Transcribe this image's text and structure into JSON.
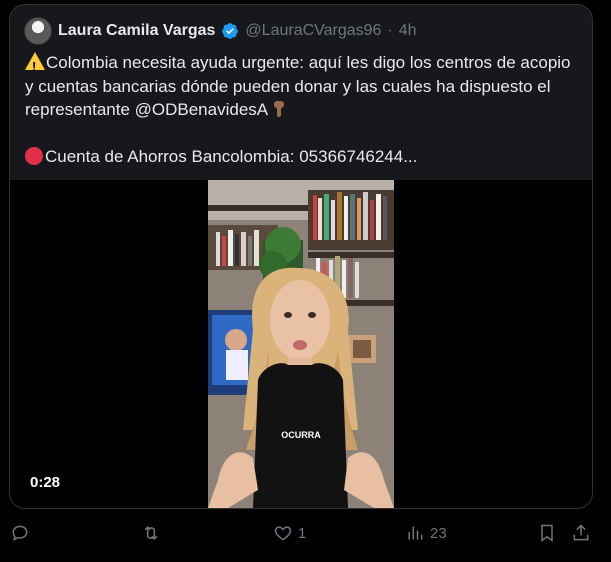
{
  "tweet": {
    "author_name": "Laura Camila Vargas",
    "handle": "@LauraCVargas96",
    "separator": "·",
    "time": "4h",
    "text_line1": "Colombia necesita ayuda urgente: aquí les digo los centros de acopio y cuentas bancarias dónde pueden donar y las cuales ha dispuesto el representante @ODBenavidesA",
    "text_line2": "Cuenta de Ahorros Bancolombia: 05366746244..."
  },
  "video": {
    "duration": "0:28",
    "caption": "OCURRA"
  },
  "actions": {
    "reply_count": "",
    "retweet_count": "",
    "like_count": "1",
    "views_count": "23"
  },
  "icons": {
    "verified": "verified-badge-icon",
    "reply": "reply-icon",
    "retweet": "retweet-icon",
    "like": "heart-icon",
    "views": "views-bar-chart-icon",
    "bookmark": "bookmark-icon",
    "share": "share-icon"
  },
  "colors": {
    "background": "#000000",
    "card": "#16181c",
    "text": "#e7e9ea",
    "muted": "#71767b",
    "verified": "#1d9bf0"
  }
}
